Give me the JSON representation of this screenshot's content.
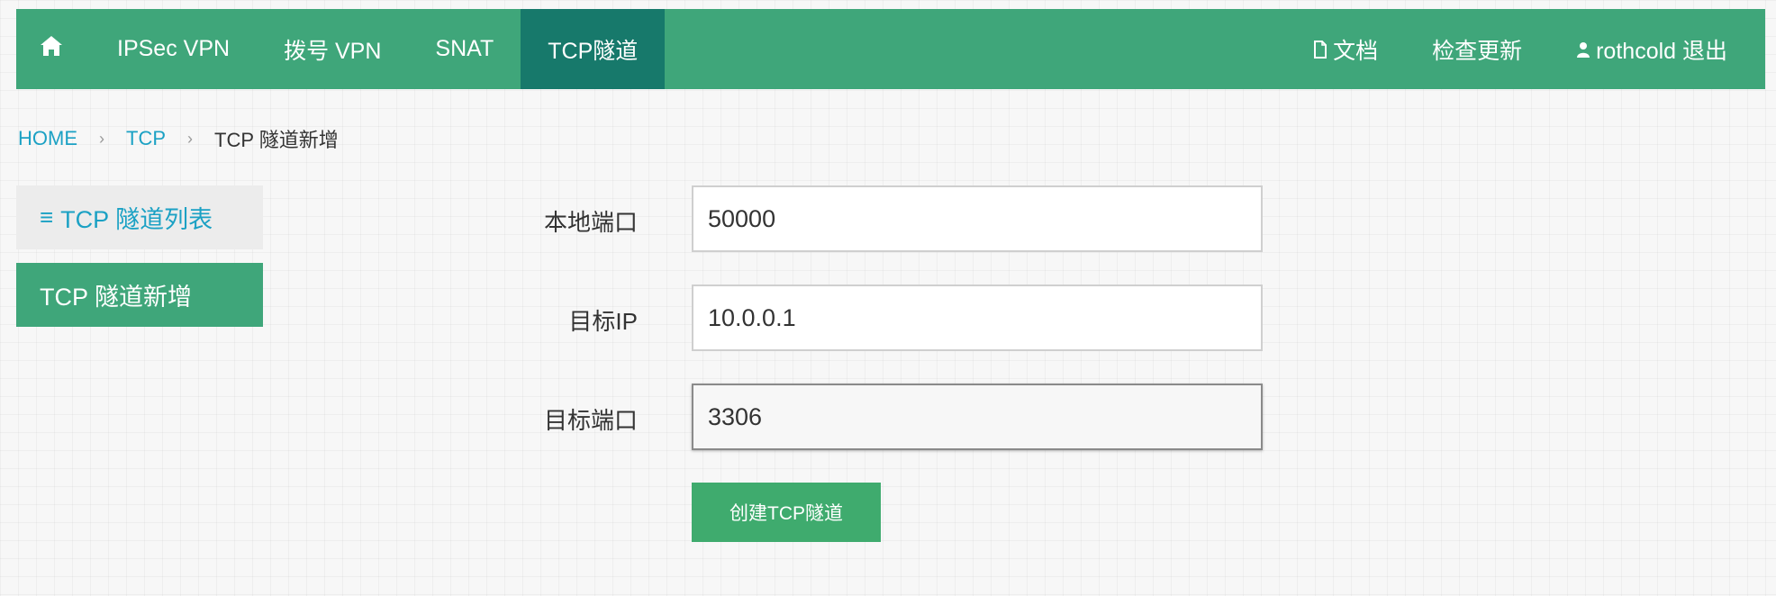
{
  "nav": {
    "home_icon": "home-icon",
    "items": [
      {
        "label": "IPSec VPN"
      },
      {
        "label": "拨号 VPN"
      },
      {
        "label": "SNAT"
      },
      {
        "label": "TCP隧道",
        "active": true
      }
    ],
    "right": {
      "docs_icon": "document-icon",
      "docs_label": "文档",
      "update_label": "检查更新",
      "user_icon": "user-icon",
      "user_label": "rothcold 退出"
    }
  },
  "breadcrumb": {
    "items": [
      "HOME",
      "TCP",
      "TCP 隧道新增"
    ],
    "separator": "›"
  },
  "sidebar": {
    "items": [
      {
        "icon": "list-icon",
        "label": "TCP 隧道列表"
      },
      {
        "label": "TCP 隧道新增",
        "active": true
      }
    ]
  },
  "form": {
    "fields": [
      {
        "label": "本地端口",
        "value": "50000"
      },
      {
        "label": "目标IP",
        "value": "10.0.0.1"
      },
      {
        "label": "目标端口",
        "value": "3306",
        "focused": true
      }
    ],
    "submit_label": "创建TCP隧道"
  },
  "colors": {
    "nav_bg": "#3fa67a",
    "nav_active": "#17796b",
    "link": "#1ba1c4",
    "button": "#3fab6e"
  }
}
